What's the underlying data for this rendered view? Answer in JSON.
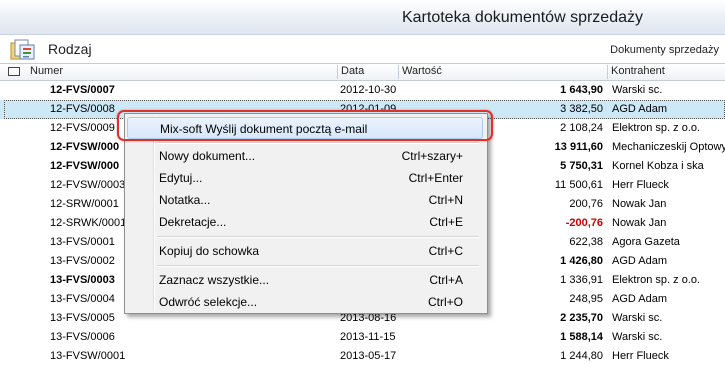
{
  "window": {
    "title": "Kartoteka dokumentów sprzedaży"
  },
  "toolbar": {
    "rodzaj_label": "Rodzaj",
    "right_label": "Dokumenty sprzedaży"
  },
  "columns": {
    "numer": "Numer",
    "data": "Data",
    "wartosc": "Wartość",
    "kontrahent": "Kontrahent"
  },
  "rows": [
    {
      "numer": "12-FVS/0007",
      "data": "2012-10-30",
      "wartosc": "1 643,90",
      "kontrahent": "Warski sc.",
      "bold": true
    },
    {
      "numer": "12-FVS/0008",
      "data": "2012-01-09",
      "wartosc": "3 382,50",
      "kontrahent": "AGD Adam",
      "bold": false,
      "selected": true
    },
    {
      "numer": "12-FVS/0009",
      "data": "",
      "wartosc": "2 108,24",
      "kontrahent": "Elektron sp. z o.o.",
      "bold": false
    },
    {
      "numer": "12-FVSW/000",
      "data": "",
      "wartosc": "13 911,60",
      "kontrahent": "Mechaniczeskij Optowyj",
      "bold": true
    },
    {
      "numer": "12-FVSW/000",
      "data": "",
      "wartosc": "5 750,31",
      "kontrahent": "Kornel Kobza i ska",
      "bold": true
    },
    {
      "numer": "12-FVSW/0003",
      "data": "",
      "wartosc": "11 500,61",
      "kontrahent": "Herr Flueck",
      "bold": false
    },
    {
      "numer": "12-SRW/0001",
      "data": "",
      "wartosc": "200,76",
      "kontrahent": "Nowak Jan",
      "bold": false
    },
    {
      "numer": "12-SRWK/0001",
      "data": "",
      "wartosc": "-200,76",
      "kontrahent": "Nowak Jan",
      "bold": false,
      "negative": true
    },
    {
      "numer": "13-FVS/0001",
      "data": "",
      "wartosc": "622,38",
      "kontrahent": "Agora Gazeta",
      "bold": false
    },
    {
      "numer": "13-FVS/0002",
      "data": "",
      "wartosc": "1 426,80",
      "kontrahent": "AGD Adam",
      "bold": true,
      "numer_bold": false
    },
    {
      "numer": "13-FVS/0003",
      "data": "",
      "wartosc": "1 336,91",
      "kontrahent": "Elektron sp. z o.o.",
      "bold": false,
      "numer_bold": true
    },
    {
      "numer": "13-FVS/0004",
      "data": "",
      "wartosc": "248,95",
      "kontrahent": "AGD Adam",
      "bold": false
    },
    {
      "numer": "13-FVS/0005",
      "data": "2013-08-16",
      "wartosc": "2 235,70",
      "kontrahent": "Warski sc.",
      "bold": true,
      "numer_bold": false
    },
    {
      "numer": "13-FVS/0006",
      "data": "2013-11-15",
      "wartosc": "1 588,14",
      "kontrahent": "Warski sc.",
      "bold": true,
      "numer_bold": false
    },
    {
      "numer": "13-FVSW/0001",
      "data": "2013-05-17",
      "wartosc": "1 244,80",
      "kontrahent": "Herr Flueck",
      "bold": false
    }
  ],
  "context_menu": {
    "items": [
      {
        "label": "Mix-soft Wyślij dokument pocztą e-mail",
        "shortcut": ""
      },
      {
        "label": "Nowy dokument...",
        "shortcut": "Ctrl+szary+"
      },
      {
        "label": "Edytuj...",
        "shortcut": "Ctrl+Enter"
      },
      {
        "label": "Notatka...",
        "shortcut": "Ctrl+N"
      },
      {
        "label": "Dekretacje...",
        "shortcut": "Ctrl+E"
      },
      {
        "label": "Kopiuj do schowka",
        "shortcut": "Ctrl+C"
      },
      {
        "label": "Zaznacz wszystkie...",
        "shortcut": "Ctrl+A"
      },
      {
        "label": "Odwróć selekcje...",
        "shortcut": "Ctrl+O"
      }
    ]
  },
  "colors": {
    "selection": "#cde8f6",
    "highlight_border": "#e0302a",
    "negative": "#d00000"
  },
  "icons": {
    "rodzaj": "document-type-icon"
  }
}
